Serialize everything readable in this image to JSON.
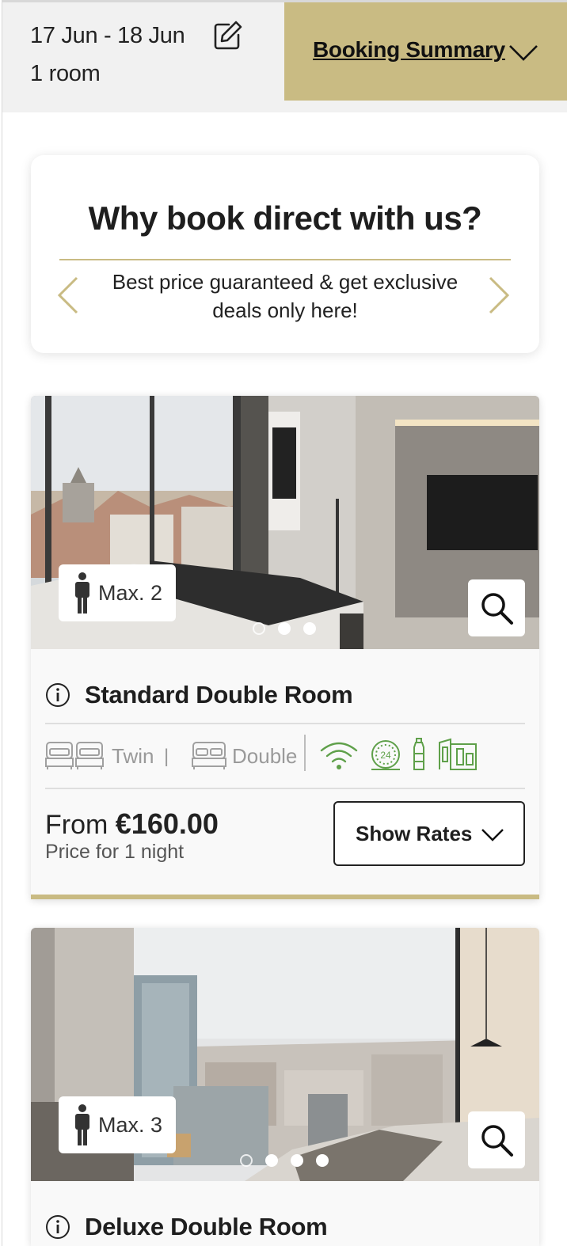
{
  "header": {
    "date_range": "17 Jun - 18 Jun",
    "rooms": "1 room",
    "summary_label": "Booking Summary"
  },
  "why_book": {
    "title": "Why book direct with us?",
    "text": "Best price guaranteed & get exclusive deals only here!"
  },
  "rooms": [
    {
      "name": "Standard Double Room",
      "max_occupancy": "Max. 2",
      "bed_twin": "Twin",
      "bed_separator": "|",
      "bed_double": "Double",
      "from_label": "From",
      "price": "€160.00",
      "price_sub": "Price for 1 night",
      "rates_label": "Show Rates",
      "carousel_active_index": 0,
      "carousel_count": 3,
      "amenity_icons": [
        "wifi-icon",
        "24h-service-icon",
        "water-bottle-icon",
        "balcony-icon"
      ]
    },
    {
      "name": "Deluxe Double Room",
      "max_occupancy": "Max. 3",
      "carousel_active_index": 0,
      "carousel_count": 4
    }
  ],
  "colors": {
    "accent_gold": "#c9bb83",
    "amenity_green": "#5fa04a",
    "header_bg": "#f1f1f1"
  }
}
